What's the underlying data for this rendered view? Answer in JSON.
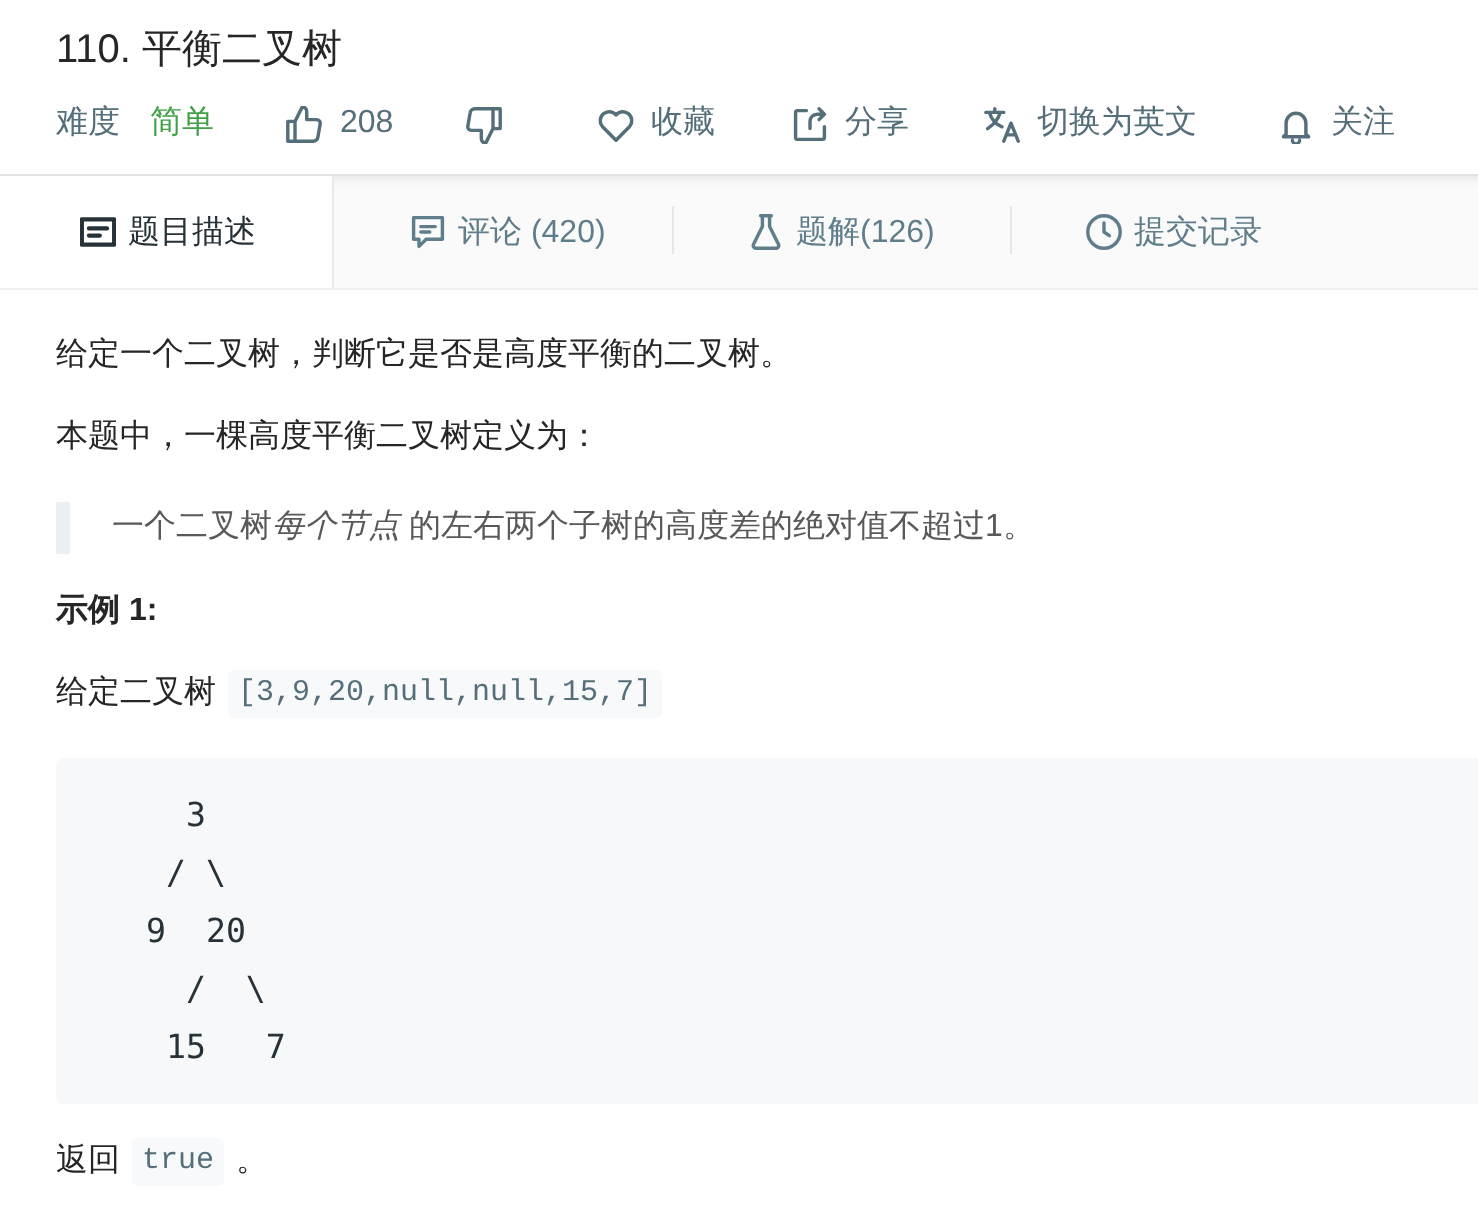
{
  "problem": {
    "title": "110. 平衡二叉树"
  },
  "meta": {
    "difficulty_label": "难度",
    "difficulty": {
      "label": "简单",
      "kind": "easy"
    },
    "actions": [
      {
        "kind": "like",
        "label": "208"
      },
      {
        "kind": "dislike"
      },
      {
        "kind": "favorite",
        "label": "收藏"
      },
      {
        "kind": "share",
        "label": "分享"
      },
      {
        "kind": "translate",
        "label": "切换为英文"
      },
      {
        "kind": "follow",
        "label": "关注"
      }
    ]
  },
  "tabs": [
    {
      "kind": "description",
      "label": "题目描述",
      "selected": true
    },
    {
      "kind": "comments",
      "label": "评论 (420)",
      "selected": false
    },
    {
      "kind": "solutions",
      "label": "题解(126)",
      "selected": false
    },
    {
      "kind": "submissions",
      "label": "提交记录",
      "selected": false
    }
  ],
  "content": [
    {
      "kind": "paragraph",
      "text": "给定一个二叉树，判断它是否是高度平衡的二叉树。"
    },
    {
      "kind": "paragraph",
      "text": "本题中，一棵高度平衡二叉树定义为："
    },
    {
      "kind": "quote",
      "segments": [
        {
          "text": "一个二叉树",
          "italic": false
        },
        {
          "text": "每个节点",
          "italic": true
        },
        {
          "text": " 的左右两个子树的高度差的绝对值不超过1。",
          "italic": false
        }
      ]
    },
    {
      "kind": "heading",
      "text": "示例 1:"
    },
    {
      "kind": "paragraph",
      "text": "给定二叉树",
      "code": "[3,9,20,null,null,15,7]"
    },
    {
      "kind": "code_block",
      "text": "    3\n   / \\\n  9  20\n    /  \\\n   15   7"
    },
    {
      "kind": "paragraph",
      "text": "返回",
      "code": "true",
      "after": "。"
    }
  ]
}
